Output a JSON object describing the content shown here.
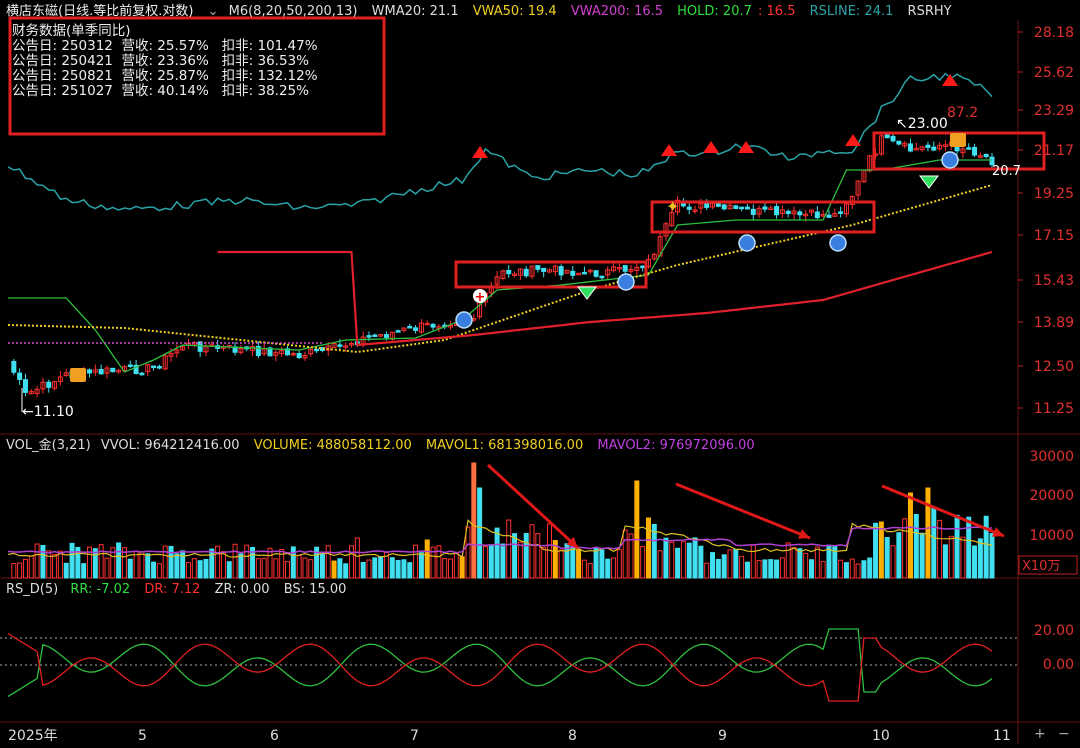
{
  "header": {
    "stock_title": "横店东磁(日线.等比前复权.对数)",
    "m6": "M6(8,20,50,200,13)",
    "wma20": "WMA20: 21.1",
    "vwa50": "VWA50: 19.4",
    "vwa200": "VWA200: 16.5",
    "hold": "HOLD: 20.7",
    "hold_val2": ": 16.5",
    "rsline": "RSLINE: 24.1",
    "rsrhy": "RSRHY"
  },
  "finance": {
    "title": "财务数据(单季同比)",
    "rows": [
      "公告日: 250312  营收: 25.57%   扣非: 101.47%",
      "公告日: 250421  营收: 23.36%   扣非: 36.53%",
      "公告日: 250821  营收: 25.87%   扣非: 132.12%",
      "公告日: 251027  营收: 40.14%   扣非: 38.25%"
    ]
  },
  "price_annotations": {
    "low": "11.10",
    "high": "23.00",
    "val_87": "87.2",
    "val_207": "20.7"
  },
  "vol_header": {
    "name": "VOL_金(3,21)",
    "vvol": "VVOL: 964212416.00",
    "volume": "VOLUME: 488058112.00",
    "mavol1": "MAVOL1: 681398016.00",
    "mavol2": "MAVOL2: 976972096.00"
  },
  "rs_header": {
    "name": "RS_D(5)",
    "rr": "RR: -7.02",
    "dr": "DR: 7.12",
    "zr": "ZR: 0.00",
    "bs": "BS: 15.00"
  },
  "vol_unit": "X10万",
  "axis": {
    "price_ticks": [
      "28.18",
      "25.62",
      "23.29",
      "21.17",
      "19.25",
      "17.15",
      "15.43",
      "13.89",
      "12.50",
      "11.25"
    ],
    "vol_ticks": [
      "30000",
      "20000",
      "10000"
    ],
    "rs_ticks": [
      "20.00",
      "0.00"
    ],
    "month_labels": [
      "2025年",
      "5",
      "6",
      "7",
      "8",
      "9",
      "10",
      "11"
    ]
  },
  "colors": {
    "up": "#ff3030",
    "down": "#40e0f0",
    "rsline": "#2aa3a8",
    "hold": "#2fbf3f",
    "vwa50": "#f0d020",
    "vwa200": "#e0202c",
    "wma": "#d050d0",
    "mavol1": "#e0c020",
    "mavol2": "#b040d0",
    "highlight": "#ffb000",
    "box": "#e02020"
  },
  "chart_data": {
    "type": "line",
    "title": "横店东磁(日线.等比前复权.对数)",
    "price_range": [
      11.1,
      23.0
    ],
    "y_ticks": [
      28.18,
      25.62,
      23.29,
      21.17,
      19.25,
      17.15,
      15.43,
      13.89,
      12.5,
      11.25
    ],
    "x_months": [
      "2025年",
      "5",
      "6",
      "7",
      "8",
      "9",
      "10",
      "11"
    ],
    "series": [
      {
        "name": "WMA20",
        "last": 21.1
      },
      {
        "name": "VWA50",
        "last": 19.4
      },
      {
        "name": "VWA200",
        "last": 16.5
      },
      {
        "name": "HOLD",
        "last": 20.7
      },
      {
        "name": "RSLINE",
        "last": 24.1
      }
    ],
    "volume": {
      "VVOL": 964212416.0,
      "VOLUME": 488058112.0,
      "MAVOL1": 681398016.0,
      "MAVOL2": 976972096.0,
      "y_ticks": [
        30000,
        20000,
        10000
      ],
      "unit": "X10万"
    },
    "rs": {
      "RR": -7.02,
      "DR": 7.12,
      "ZR": 0.0,
      "BS": 15.0,
      "y_ticks": [
        20.0,
        0.0
      ]
    }
  }
}
